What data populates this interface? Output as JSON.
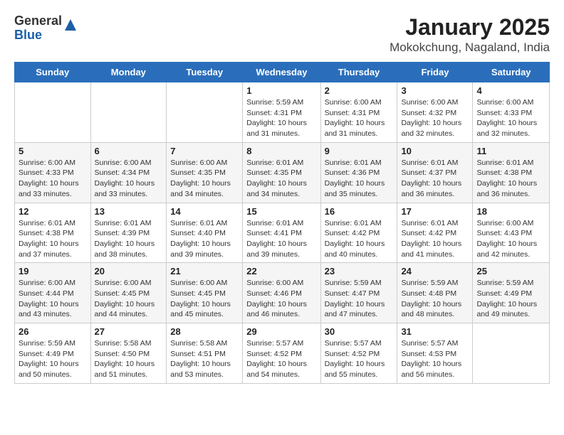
{
  "header": {
    "logo": {
      "general": "General",
      "blue": "Blue"
    },
    "title": "January 2025",
    "subtitle": "Mokokchung, Nagaland, India"
  },
  "weekdays": [
    "Sunday",
    "Monday",
    "Tuesday",
    "Wednesday",
    "Thursday",
    "Friday",
    "Saturday"
  ],
  "weeks": [
    [
      {
        "day": "",
        "info": ""
      },
      {
        "day": "",
        "info": ""
      },
      {
        "day": "",
        "info": ""
      },
      {
        "day": "1",
        "info": "Sunrise: 5:59 AM\nSunset: 4:31 PM\nDaylight: 10 hours and 31 minutes."
      },
      {
        "day": "2",
        "info": "Sunrise: 6:00 AM\nSunset: 4:31 PM\nDaylight: 10 hours and 31 minutes."
      },
      {
        "day": "3",
        "info": "Sunrise: 6:00 AM\nSunset: 4:32 PM\nDaylight: 10 hours and 32 minutes."
      },
      {
        "day": "4",
        "info": "Sunrise: 6:00 AM\nSunset: 4:33 PM\nDaylight: 10 hours and 32 minutes."
      }
    ],
    [
      {
        "day": "5",
        "info": "Sunrise: 6:00 AM\nSunset: 4:33 PM\nDaylight: 10 hours and 33 minutes."
      },
      {
        "day": "6",
        "info": "Sunrise: 6:00 AM\nSunset: 4:34 PM\nDaylight: 10 hours and 33 minutes."
      },
      {
        "day": "7",
        "info": "Sunrise: 6:00 AM\nSunset: 4:35 PM\nDaylight: 10 hours and 34 minutes."
      },
      {
        "day": "8",
        "info": "Sunrise: 6:01 AM\nSunset: 4:35 PM\nDaylight: 10 hours and 34 minutes."
      },
      {
        "day": "9",
        "info": "Sunrise: 6:01 AM\nSunset: 4:36 PM\nDaylight: 10 hours and 35 minutes."
      },
      {
        "day": "10",
        "info": "Sunrise: 6:01 AM\nSunset: 4:37 PM\nDaylight: 10 hours and 36 minutes."
      },
      {
        "day": "11",
        "info": "Sunrise: 6:01 AM\nSunset: 4:38 PM\nDaylight: 10 hours and 36 minutes."
      }
    ],
    [
      {
        "day": "12",
        "info": "Sunrise: 6:01 AM\nSunset: 4:38 PM\nDaylight: 10 hours and 37 minutes."
      },
      {
        "day": "13",
        "info": "Sunrise: 6:01 AM\nSunset: 4:39 PM\nDaylight: 10 hours and 38 minutes."
      },
      {
        "day": "14",
        "info": "Sunrise: 6:01 AM\nSunset: 4:40 PM\nDaylight: 10 hours and 39 minutes."
      },
      {
        "day": "15",
        "info": "Sunrise: 6:01 AM\nSunset: 4:41 PM\nDaylight: 10 hours and 39 minutes."
      },
      {
        "day": "16",
        "info": "Sunrise: 6:01 AM\nSunset: 4:42 PM\nDaylight: 10 hours and 40 minutes."
      },
      {
        "day": "17",
        "info": "Sunrise: 6:01 AM\nSunset: 4:42 PM\nDaylight: 10 hours and 41 minutes."
      },
      {
        "day": "18",
        "info": "Sunrise: 6:00 AM\nSunset: 4:43 PM\nDaylight: 10 hours and 42 minutes."
      }
    ],
    [
      {
        "day": "19",
        "info": "Sunrise: 6:00 AM\nSunset: 4:44 PM\nDaylight: 10 hours and 43 minutes."
      },
      {
        "day": "20",
        "info": "Sunrise: 6:00 AM\nSunset: 4:45 PM\nDaylight: 10 hours and 44 minutes."
      },
      {
        "day": "21",
        "info": "Sunrise: 6:00 AM\nSunset: 4:45 PM\nDaylight: 10 hours and 45 minutes."
      },
      {
        "day": "22",
        "info": "Sunrise: 6:00 AM\nSunset: 4:46 PM\nDaylight: 10 hours and 46 minutes."
      },
      {
        "day": "23",
        "info": "Sunrise: 5:59 AM\nSunset: 4:47 PM\nDaylight: 10 hours and 47 minutes."
      },
      {
        "day": "24",
        "info": "Sunrise: 5:59 AM\nSunset: 4:48 PM\nDaylight: 10 hours and 48 minutes."
      },
      {
        "day": "25",
        "info": "Sunrise: 5:59 AM\nSunset: 4:49 PM\nDaylight: 10 hours and 49 minutes."
      }
    ],
    [
      {
        "day": "26",
        "info": "Sunrise: 5:59 AM\nSunset: 4:49 PM\nDaylight: 10 hours and 50 minutes."
      },
      {
        "day": "27",
        "info": "Sunrise: 5:58 AM\nSunset: 4:50 PM\nDaylight: 10 hours and 51 minutes."
      },
      {
        "day": "28",
        "info": "Sunrise: 5:58 AM\nSunset: 4:51 PM\nDaylight: 10 hours and 53 minutes."
      },
      {
        "day": "29",
        "info": "Sunrise: 5:57 AM\nSunset: 4:52 PM\nDaylight: 10 hours and 54 minutes."
      },
      {
        "day": "30",
        "info": "Sunrise: 5:57 AM\nSunset: 4:52 PM\nDaylight: 10 hours and 55 minutes."
      },
      {
        "day": "31",
        "info": "Sunrise: 5:57 AM\nSunset: 4:53 PM\nDaylight: 10 hours and 56 minutes."
      },
      {
        "day": "",
        "info": ""
      }
    ]
  ]
}
